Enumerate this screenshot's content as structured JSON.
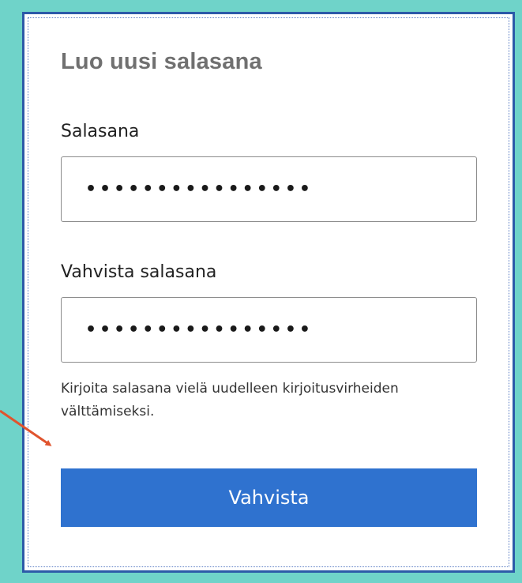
{
  "dialog": {
    "title": "Luo uusi salasana",
    "password_label": "Salasana",
    "password_value": "••••••••••••••••",
    "confirm_label": "Vahvista salasana",
    "confirm_value": "••••••••••••••••",
    "hint": "Kirjoita salasana vielä uudelleen kirjoitusvirheiden välttämiseksi.",
    "submit_label": "Vahvista"
  },
  "annotation": {
    "icon": "arrow-icon",
    "color": "#e0542e"
  },
  "colors": {
    "background": "#6fd3c9",
    "frame_border": "#2c5aa8",
    "button": "#2f72cf"
  }
}
